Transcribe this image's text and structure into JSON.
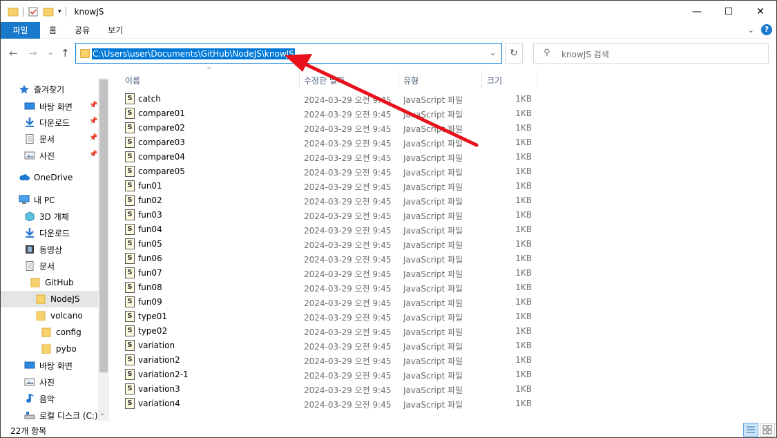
{
  "window": {
    "title": "knowJS",
    "minimize": "—",
    "maximize": "☐",
    "close": "✕"
  },
  "ribbon": {
    "tabs": [
      "파일",
      "홈",
      "공유",
      "보기"
    ]
  },
  "address": {
    "path": "C:\\Users\\user\\Documents\\GitHub\\NodeJS\\knowJS"
  },
  "search": {
    "placeholder": "knowJS 검색"
  },
  "sidebar": {
    "items": [
      {
        "label": "즐겨찾기",
        "icon": "star-icon"
      },
      {
        "label": "바탕 화면",
        "icon": "desktop-icon",
        "pinned": true
      },
      {
        "label": "다운로드",
        "icon": "download-icon",
        "pinned": true
      },
      {
        "label": "문서",
        "icon": "document-icon",
        "pinned": true
      },
      {
        "label": "사진",
        "icon": "picture-icon",
        "pinned": true
      },
      {
        "label": "OneDrive",
        "icon": "cloud-icon"
      },
      {
        "label": "내 PC",
        "icon": "pc-icon"
      },
      {
        "label": "3D 개체",
        "icon": "cube-icon"
      },
      {
        "label": "다운로드",
        "icon": "download-icon"
      },
      {
        "label": "동영상",
        "icon": "video-icon"
      },
      {
        "label": "문서",
        "icon": "document-icon"
      },
      {
        "label": "GitHub",
        "icon": "folder-icon"
      },
      {
        "label": "NodeJS",
        "icon": "folder-icon",
        "selected": true
      },
      {
        "label": "volcano",
        "icon": "folder-icon"
      },
      {
        "label": "config",
        "icon": "folder-icon"
      },
      {
        "label": "pybo",
        "icon": "folder-icon"
      },
      {
        "label": "바탕 화면",
        "icon": "desktop-icon"
      },
      {
        "label": "사진",
        "icon": "picture-icon"
      },
      {
        "label": "음악",
        "icon": "music-icon"
      },
      {
        "label": "로컬 디스크 (C:)",
        "icon": "drive-icon"
      }
    ]
  },
  "columns": {
    "name": "이름",
    "date": "수정한 날짜",
    "type": "유형",
    "size": "크기"
  },
  "files": [
    {
      "name": "catch",
      "date": "2024-03-29 오전 9:45",
      "type": "JavaScript 파일",
      "size": "1KB"
    },
    {
      "name": "compare01",
      "date": "2024-03-29 오전 9:45",
      "type": "JavaScript 파일",
      "size": "1KB"
    },
    {
      "name": "compare02",
      "date": "2024-03-29 오전 9:45",
      "type": "JavaScript 파일",
      "size": "1KB"
    },
    {
      "name": "compare03",
      "date": "2024-03-29 오전 9:45",
      "type": "JavaScript 파일",
      "size": "1KB"
    },
    {
      "name": "compare04",
      "date": "2024-03-29 오전 9:45",
      "type": "JavaScript 파일",
      "size": "1KB"
    },
    {
      "name": "compare05",
      "date": "2024-03-29 오전 9:45",
      "type": "JavaScript 파일",
      "size": "1KB"
    },
    {
      "name": "fun01",
      "date": "2024-03-29 오전 9:45",
      "type": "JavaScript 파일",
      "size": "1KB"
    },
    {
      "name": "fun02",
      "date": "2024-03-29 오전 9:45",
      "type": "JavaScript 파일",
      "size": "1KB"
    },
    {
      "name": "fun03",
      "date": "2024-03-29 오전 9:45",
      "type": "JavaScript 파일",
      "size": "1KB"
    },
    {
      "name": "fun04",
      "date": "2024-03-29 오전 9:45",
      "type": "JavaScript 파일",
      "size": "1KB"
    },
    {
      "name": "fun05",
      "date": "2024-03-29 오전 9:45",
      "type": "JavaScript 파일",
      "size": "1KB"
    },
    {
      "name": "fun06",
      "date": "2024-03-29 오전 9:45",
      "type": "JavaScript 파일",
      "size": "1KB"
    },
    {
      "name": "fun07",
      "date": "2024-03-29 오전 9:45",
      "type": "JavaScript 파일",
      "size": "1KB"
    },
    {
      "name": "fun08",
      "date": "2024-03-29 오전 9:45",
      "type": "JavaScript 파일",
      "size": "1KB"
    },
    {
      "name": "fun09",
      "date": "2024-03-29 오전 9:45",
      "type": "JavaScript 파일",
      "size": "1KB"
    },
    {
      "name": "type01",
      "date": "2024-03-29 오전 9:45",
      "type": "JavaScript 파일",
      "size": "1KB"
    },
    {
      "name": "type02",
      "date": "2024-03-29 오전 9:45",
      "type": "JavaScript 파일",
      "size": "1KB"
    },
    {
      "name": "variation",
      "date": "2024-03-29 오전 9:45",
      "type": "JavaScript 파일",
      "size": "1KB"
    },
    {
      "name": "variation2",
      "date": "2024-03-29 오전 9:45",
      "type": "JavaScript 파일",
      "size": "1KB"
    },
    {
      "name": "variation2-1",
      "date": "2024-03-29 오전 9:45",
      "type": "JavaScript 파일",
      "size": "1KB"
    },
    {
      "name": "variation3",
      "date": "2024-03-29 오전 9:45",
      "type": "JavaScript 파일",
      "size": "1KB"
    },
    {
      "name": "variation4",
      "date": "2024-03-29 오전 9:45",
      "type": "JavaScript 파일",
      "size": "1KB"
    }
  ],
  "status": {
    "count": "22개 항목"
  },
  "colors": {
    "accent": "#0078d7",
    "file_tab": "#1979ca",
    "annotation_arrow": "#e8101a"
  }
}
